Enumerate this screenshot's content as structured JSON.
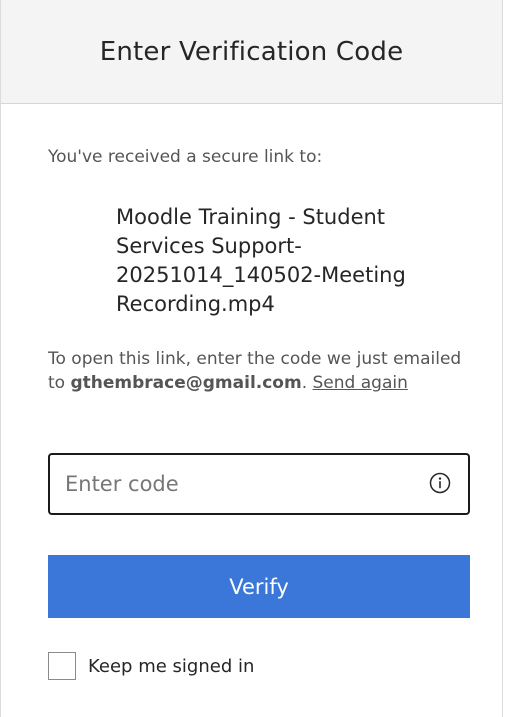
{
  "header": {
    "title": "Enter Verification Code"
  },
  "intro": {
    "text": "You've received a secure link to:"
  },
  "file": {
    "name": "Moodle Training - Student Services Support-20251014_140502-Meeting Recording.mp4"
  },
  "instructions": {
    "prefix": "To open this link, enter the code we just emailed to ",
    "email": "gthembrace@gmail.com",
    "separator": ". ",
    "send_again_label": "Send again"
  },
  "code_input": {
    "placeholder": "Enter code",
    "value": "",
    "info_icon": "info-circle-icon"
  },
  "verify_button": {
    "label": "Verify"
  },
  "keep_signed_in": {
    "label": "Keep me signed in",
    "checked": false
  },
  "colors": {
    "accent": "#3b77d8",
    "header_bg": "#f4f4f4",
    "input_border": "#1a1a1a"
  }
}
